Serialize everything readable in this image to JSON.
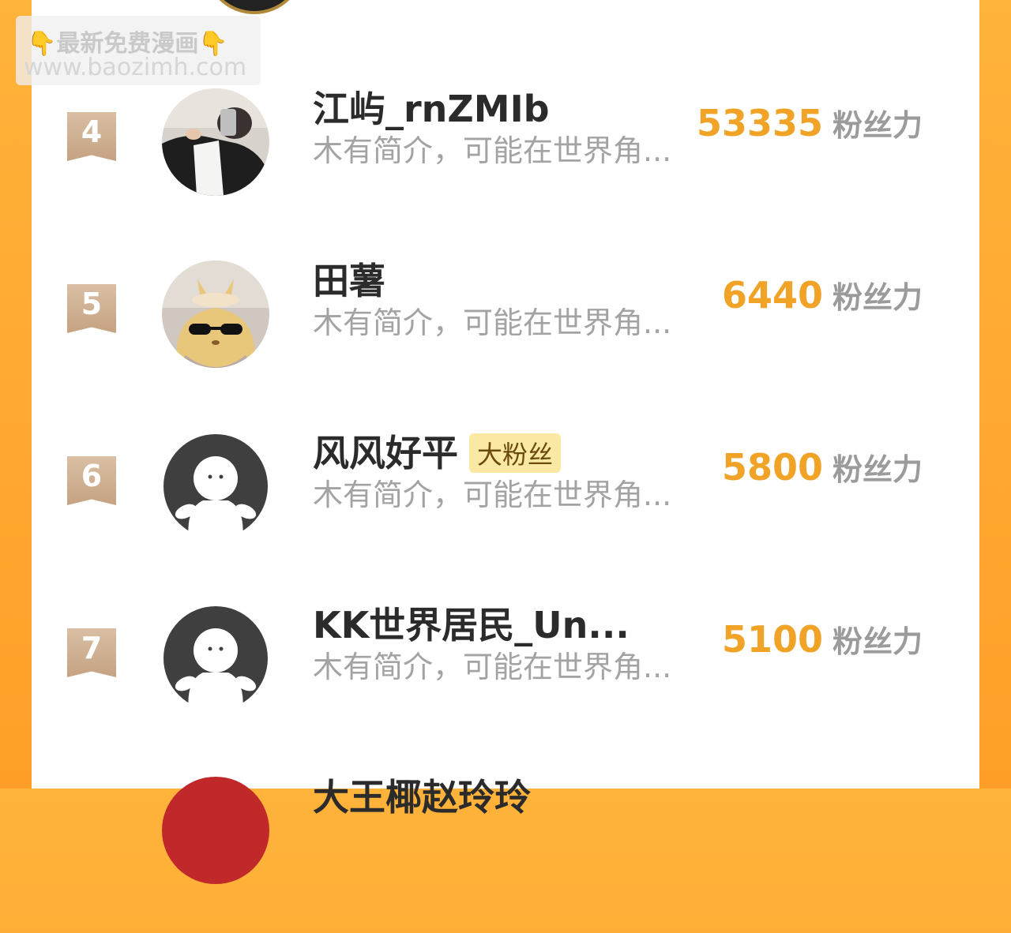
{
  "watermark": {
    "line1": "最新免费漫画",
    "line2": "www.baozimh.com",
    "emoji_left": "👇",
    "emoji_right": "👇"
  },
  "unit_label": "粉丝力",
  "rows": [
    {
      "rank": "4",
      "name": "江屿_rnZMIb",
      "desc": "木有简介，可能在世界角...",
      "score": "53335",
      "avatar": "photo-dark-clothes"
    },
    {
      "rank": "5",
      "name": "田薯",
      "desc": "木有简介，可能在世界角...",
      "score": "6440",
      "avatar": "plush-toy-sunglasses"
    },
    {
      "rank": "6",
      "name": "风风好平",
      "tag": "大粉丝",
      "desc": "木有简介，可能在世界角...",
      "score": "5800",
      "avatar": "default-avatar"
    },
    {
      "rank": "7",
      "name": "KK世界居民_Un...",
      "desc": "木有简介，可能在世界角...",
      "score": "5100",
      "avatar": "default-avatar"
    },
    {
      "rank": "",
      "name": "大王椰赵玲玲",
      "desc": "",
      "score": "",
      "avatar": "photo-red-bg"
    }
  ],
  "colors": {
    "accent": "#f0a326",
    "badge": "#c5a282",
    "background": "#ff9f2a"
  }
}
